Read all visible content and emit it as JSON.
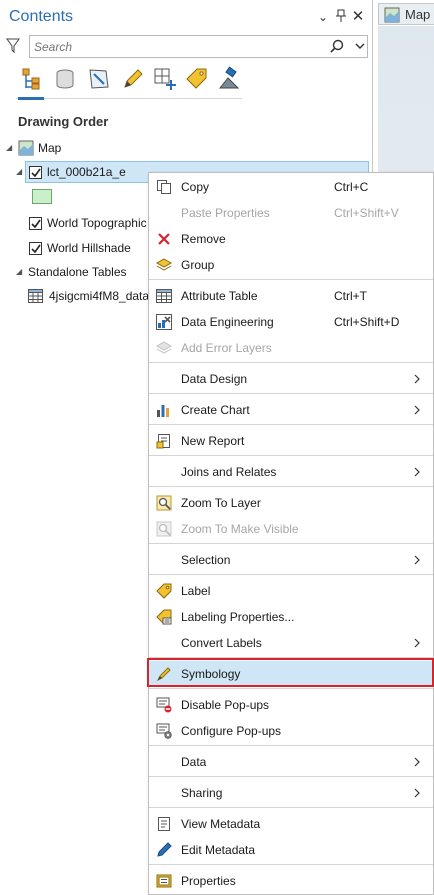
{
  "pane": {
    "title": "Contents",
    "search_placeholder": "Search",
    "drawing_order": "Drawing Order",
    "view_buttons": [
      "drawing-order-view",
      "data-source-view",
      "selection-view",
      "editing-view",
      "snapping-view",
      "labeling-view",
      "perspective-imagery-view"
    ]
  },
  "tree": {
    "map": "Map",
    "layer": "lct_000b21a_e",
    "topo": "World Topographic",
    "hillshade": "World Hillshade",
    "standalone": "Standalone Tables",
    "table": "4jsigcmi4fM8_data"
  },
  "map_tab": {
    "label": "Map"
  },
  "menu": {
    "copy": "Copy",
    "copy_short": "Ctrl+C",
    "paste_props": "Paste Properties",
    "paste_short": "Ctrl+Shift+V",
    "remove": "Remove",
    "group": "Group",
    "attr_table": "Attribute Table",
    "attr_short": "Ctrl+T",
    "data_eng": "Data Engineering",
    "data_eng_short": "Ctrl+Shift+D",
    "add_error": "Add Error Layers",
    "data_design": "Data Design",
    "create_chart": "Create Chart",
    "new_report": "New Report",
    "joins": "Joins and Relates",
    "zoom_layer": "Zoom To Layer",
    "zoom_visible": "Zoom To Make Visible",
    "selection": "Selection",
    "label": "Label",
    "label_props": "Labeling Properties...",
    "convert_labels": "Convert Labels",
    "symbology": "Symbology",
    "disable_popups": "Disable Pop-ups",
    "config_popups": "Configure Pop-ups",
    "data": "Data",
    "sharing": "Sharing",
    "view_meta": "View Metadata",
    "edit_meta": "Edit Metadata",
    "properties": "Properties"
  },
  "colors": {
    "accent": "#2a6fb6",
    "selected": "#cfe6f7",
    "highlight_border": "#d8232a"
  }
}
